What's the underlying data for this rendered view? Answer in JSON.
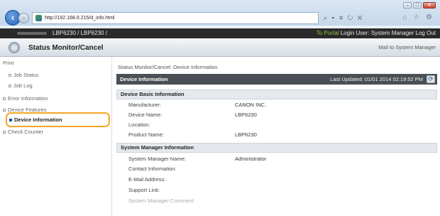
{
  "browser": {
    "url": "http://192.168.0.215/d_info.html",
    "address_tools": "⌕ ▾ ≡ ↻ ✕",
    "home_tools": "⌂ ☆ ⚙",
    "window_buttons": [
      "–",
      "□",
      "✕"
    ]
  },
  "topbar": {
    "model": "LBP6230 / LBP6230 /",
    "portal": "To Portal",
    "login_user": "Login User: System Manager",
    "logout": "Log Out"
  },
  "header": {
    "title": "Status Monitor/Cancel",
    "mail_button": "Mail to System Manager"
  },
  "sidebar": {
    "items": [
      {
        "label": "Print"
      },
      {
        "label": "Job Status"
      },
      {
        "label": "Job Log"
      },
      {
        "label": "Error Information"
      },
      {
        "label": "Device Features"
      },
      {
        "label": "Device Information"
      },
      {
        "label": "Check Counter"
      }
    ]
  },
  "main": {
    "breadcrumb": "Status Monitor/Cancel: Device Information",
    "panel_title": "Device Information",
    "last_updated": "Last Updated: 01/01 2014 02:19:52 PM",
    "sections": [
      {
        "title": "Device Basic Information",
        "rows": [
          {
            "label": "Manufacturer:",
            "value": "CANON INC."
          },
          {
            "label": "Device Name:",
            "value": "LBP6230"
          },
          {
            "label": "Location:",
            "value": ""
          },
          {
            "label": "Product Name:",
            "value": "LBP6230"
          }
        ]
      },
      {
        "title": "System Manager Information",
        "rows": [
          {
            "label": "System Manager Name:",
            "value": "Administrator"
          },
          {
            "label": "Contact Information:",
            "value": ""
          },
          {
            "label": "E-Mail Address:",
            "value": ""
          },
          {
            "label": "Support Link:",
            "value": ""
          },
          {
            "label": "System Manager Comment:",
            "value": ""
          }
        ]
      }
    ]
  }
}
